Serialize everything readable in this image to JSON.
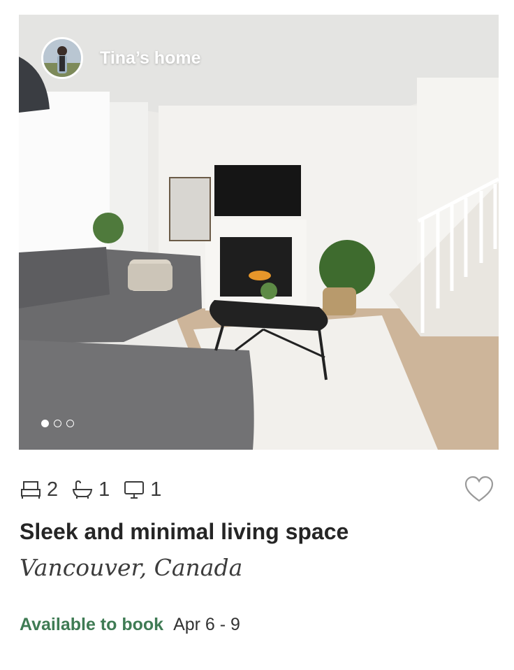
{
  "listing": {
    "host_name": "Tina’s home",
    "photo_count": 3,
    "photo_active_index": 0,
    "amenities": [
      {
        "icon": "bed-icon",
        "count": "2"
      },
      {
        "icon": "bathtub-icon",
        "count": "1"
      },
      {
        "icon": "desk-monitor-icon",
        "count": "1"
      }
    ],
    "favorite_icon": "heart-outline-icon",
    "title": "Sleek and minimal living space",
    "location": "Vancouver, Canada",
    "availability": {
      "status": "Available to book",
      "dates": "Apr 6 - 9"
    }
  },
  "colors": {
    "accent_green": "#3f7b54",
    "text_dark": "#252525"
  }
}
